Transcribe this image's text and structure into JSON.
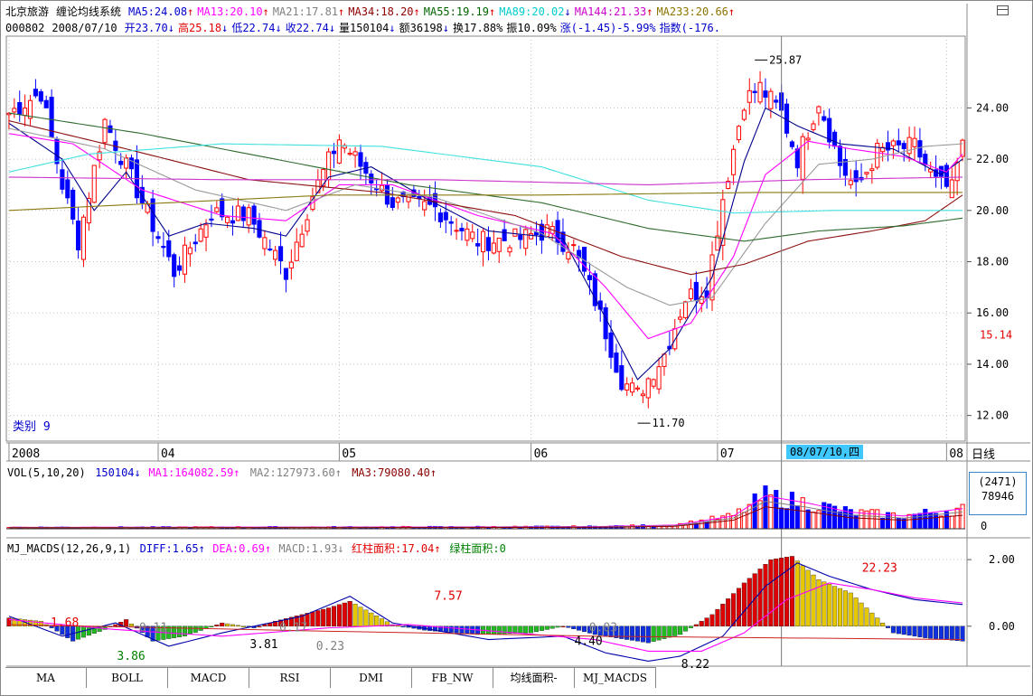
{
  "header": {
    "stock_name": "北京旅游",
    "system_name": "缠论均线系统",
    "ma_items": [
      {
        "label": "MA5:24.08",
        "arrow": "↑",
        "color": "#0000cc"
      },
      {
        "label": "MA13:20.10",
        "arrow": "↑",
        "color": "#ff00ff"
      },
      {
        "label": "MA21:17.81",
        "arrow": "↑",
        "color": "#808080"
      },
      {
        "label": "MA34:18.20",
        "arrow": "↑",
        "color": "#8b0000"
      },
      {
        "label": "MA55:19.19",
        "arrow": "↑",
        "color": "#006400"
      },
      {
        "label": "MA89:20.02",
        "arrow": "↓",
        "color": "#00cccc"
      },
      {
        "label": "MA144:21.33",
        "arrow": "↑",
        "color": "#cc00cc"
      },
      {
        "label": "MA233:20.66",
        "arrow": "↑",
        "color": "#8b7500"
      }
    ],
    "code": "000802",
    "date": "2008/07/10",
    "quote_items": [
      {
        "label": "开23.70",
        "arrow": "↓",
        "color": "#0000cc"
      },
      {
        "label": "高25.18",
        "arrow": "↓",
        "color": "#e00000"
      },
      {
        "label": "低22.74",
        "arrow": "↓",
        "color": "#0000cc"
      },
      {
        "label": "收22.74",
        "arrow": "↓",
        "color": "#0000cc"
      },
      {
        "label": "量150104",
        "arrow": "↓",
        "color": "#000000"
      },
      {
        "label": "额36198",
        "arrow": "↓",
        "color": "#000000"
      },
      {
        "label": "换17.88%",
        "arrow": "",
        "color": "#000000"
      },
      {
        "label": "振10.09%",
        "arrow": "",
        "color": "#000000"
      },
      {
        "label": "涨(-1.45)-5.99%",
        "arrow": "",
        "color": "#0000cc"
      },
      {
        "label": "指数(-176.",
        "arrow": "",
        "color": "#0000cc"
      }
    ]
  },
  "colors": {
    "up": "#ff0000",
    "down": "#0000ff",
    "macd_pos_strong": "#dd0000",
    "macd_pos_fade": "#e6c800",
    "macd_neg_strong": "#1030e0",
    "macd_neg_fade": "#22bb22",
    "grid": "#c0c0c0",
    "axis": "#808080"
  },
  "chart_data": [
    {
      "type": "candlestick",
      "title": "北京旅游 缠论均线系统",
      "ylim": [
        11.0,
        26.8
      ],
      "y_ticks": [
        "24.00",
        "22.00",
        "20.00",
        "18.00",
        "16.00",
        "14.00",
        "12.00"
      ],
      "y_tick_values": [
        24,
        22,
        20,
        18,
        16,
        14,
        12
      ],
      "current_price_label": "15.14",
      "current_price": 15.14,
      "x_tick_labels": [
        "2008",
        "04",
        "05",
        "06",
        "07",
        "08"
      ],
      "x_tick_index": [
        0,
        28,
        62,
        98,
        133,
        176
      ],
      "annotations": [
        {
          "text": "25.87",
          "index": 140,
          "value": 25.87
        },
        {
          "text": "11.70",
          "index": 118,
          "value": 11.7
        }
      ],
      "category_label": "类别 9",
      "cursor_date": "08/07/10,四",
      "period": "日线",
      "n_bars": 180,
      "anchors_close": [
        [
          0,
          23.8
        ],
        [
          6,
          24.6
        ],
        [
          10,
          21.0
        ],
        [
          13,
          18.8
        ],
        [
          18,
          23.5
        ],
        [
          24,
          20.8
        ],
        [
          31,
          17.6
        ],
        [
          38,
          19.9
        ],
        [
          45,
          19.8
        ],
        [
          52,
          17.6
        ],
        [
          57,
          20.6
        ],
        [
          62,
          22.8
        ],
        [
          67,
          21.5
        ],
        [
          72,
          20.3
        ],
        [
          80,
          20.1
        ],
        [
          88,
          18.8
        ],
        [
          96,
          18.9
        ],
        [
          101,
          19.2
        ],
        [
          106,
          18.5
        ],
        [
          110,
          16.5
        ],
        [
          115,
          13.4
        ],
        [
          118,
          12.8
        ],
        [
          123,
          14.4
        ],
        [
          127,
          16.6
        ],
        [
          131,
          17.0
        ],
        [
          134,
          20.5
        ],
        [
          138,
          24.3
        ],
        [
          141,
          24.8
        ],
        [
          145,
          23.8
        ],
        [
          148,
          22.0
        ],
        [
          152,
          24.3
        ],
        [
          156,
          21.8
        ],
        [
          159,
          20.8
        ],
        [
          163,
          22.3
        ],
        [
          170,
          22.5
        ],
        [
          174,
          21.1
        ],
        [
          177,
          20.8
        ],
        [
          179,
          22.74
        ]
      ],
      "ma_anchors": [
        {
          "name": "MA5",
          "color": "#00008b",
          "anchors": [
            [
              0,
              23.4
            ],
            [
              10,
              22.0
            ],
            [
              16,
              20.0
            ],
            [
              22,
              21.5
            ],
            [
              30,
              19.0
            ],
            [
              37,
              19.5
            ],
            [
              46,
              19.3
            ],
            [
              52,
              19.0
            ],
            [
              60,
              21.3
            ],
            [
              68,
              21.7
            ],
            [
              78,
              20.5
            ],
            [
              90,
              19.2
            ],
            [
              104,
              18.9
            ],
            [
              112,
              15.8
            ],
            [
              118,
              13.4
            ],
            [
              124,
              14.6
            ],
            [
              132,
              17.4
            ],
            [
              138,
              21.9
            ],
            [
              142,
              24.0
            ],
            [
              148,
              23.3
            ],
            [
              156,
              22.6
            ],
            [
              166,
              22.4
            ],
            [
              175,
              21.4
            ],
            [
              179,
              22.0
            ]
          ]
        },
        {
          "name": "MA13",
          "color": "#ff00ff",
          "anchors": [
            [
              0,
              23.0
            ],
            [
              12,
              22.6
            ],
            [
              25,
              20.8
            ],
            [
              40,
              19.8
            ],
            [
              52,
              19.6
            ],
            [
              62,
              21.0
            ],
            [
              72,
              21.0
            ],
            [
              88,
              19.8
            ],
            [
              102,
              19.1
            ],
            [
              112,
              17.0
            ],
            [
              120,
              15.0
            ],
            [
              128,
              15.6
            ],
            [
              136,
              18.2
            ],
            [
              142,
              21.4
            ],
            [
              150,
              22.7
            ],
            [
              158,
              22.4
            ],
            [
              168,
              22.1
            ],
            [
              176,
              21.5
            ],
            [
              179,
              22.2
            ]
          ]
        },
        {
          "name": "MA21",
          "color": "#9a9a9a",
          "anchors": [
            [
              0,
              23.2
            ],
            [
              18,
              22.4
            ],
            [
              35,
              20.8
            ],
            [
              52,
              20.0
            ],
            [
              65,
              21.0
            ],
            [
              80,
              20.5
            ],
            [
              100,
              19.1
            ],
            [
              116,
              17.0
            ],
            [
              124,
              16.3
            ],
            [
              132,
              16.6
            ],
            [
              142,
              19.5
            ],
            [
              152,
              21.8
            ],
            [
              162,
              22.0
            ],
            [
              172,
              22.5
            ],
            [
              179,
              22.6
            ]
          ]
        },
        {
          "name": "MA34",
          "color": "#8b1010",
          "anchors": [
            [
              0,
              23.5
            ],
            [
              22,
              22.4
            ],
            [
              45,
              21.2
            ],
            [
              70,
              20.7
            ],
            [
              95,
              19.8
            ],
            [
              115,
              18.2
            ],
            [
              128,
              17.5
            ],
            [
              138,
              17.9
            ],
            [
              150,
              18.8
            ],
            [
              162,
              19.2
            ],
            [
              172,
              19.6
            ],
            [
              179,
              20.6
            ]
          ]
        },
        {
          "name": "MA55",
          "color": "#2e6b2e",
          "anchors": [
            [
              0,
              23.8
            ],
            [
              25,
              23.0
            ],
            [
              50,
              22.0
            ],
            [
              75,
              21.0
            ],
            [
              100,
              20.3
            ],
            [
              120,
              19.3
            ],
            [
              138,
              18.8
            ],
            [
              152,
              19.2
            ],
            [
              168,
              19.4
            ],
            [
              179,
              19.7
            ]
          ]
        },
        {
          "name": "MA89",
          "color": "#40e0e0",
          "anchors": [
            [
              0,
              21.5
            ],
            [
              15,
              22.2
            ],
            [
              40,
              22.6
            ],
            [
              70,
              22.5
            ],
            [
              100,
              21.7
            ],
            [
              120,
              20.4
            ],
            [
              136,
              19.9
            ],
            [
              155,
              20.0
            ],
            [
              179,
              20.0
            ]
          ]
        },
        {
          "name": "MA144",
          "color": "#cc33cc",
          "anchors": [
            [
              0,
              21.3
            ],
            [
              40,
              21.2
            ],
            [
              80,
              21.2
            ],
            [
              120,
              21.0
            ],
            [
              150,
              21.2
            ],
            [
              179,
              21.3
            ]
          ]
        },
        {
          "name": "MA233",
          "color": "#8b7a10",
          "anchors": [
            [
              0,
              20.0
            ],
            [
              30,
              20.3
            ],
            [
              60,
              20.6
            ],
            [
              100,
              20.6
            ],
            [
              140,
              20.7
            ],
            [
              179,
              20.7
            ]
          ]
        }
      ]
    },
    {
      "type": "bar",
      "title": "VOL(5,10,20)",
      "value_label": "150104",
      "legend": [
        {
          "label": "VOL(5,10,20)",
          "color": "#000000"
        },
        {
          "label": "150104",
          "arrow": "↓",
          "color": "#0000cc"
        },
        {
          "label": "MA1:164082.59",
          "arrow": "↑",
          "color": "#ff00ff"
        },
        {
          "label": "MA2:127973.60",
          "arrow": "↑",
          "color": "#808080"
        },
        {
          "label": "MA3:79080.40",
          "arrow": "↑",
          "color": "#8b0000"
        }
      ],
      "y_labels": [
        "(2471)",
        "78946",
        "0"
      ],
      "volume_anchors": [
        [
          0,
          0.04
        ],
        [
          80,
          0.05
        ],
        [
          110,
          0.06
        ],
        [
          125,
          0.1
        ],
        [
          136,
          0.35
        ],
        [
          142,
          0.9
        ],
        [
          150,
          0.7
        ],
        [
          158,
          0.45
        ],
        [
          168,
          0.35
        ],
        [
          179,
          0.55
        ]
      ]
    },
    {
      "type": "bar",
      "title": "MJ_MACDS(12,26,9,1)",
      "legend": [
        {
          "label": "MJ_MACDS(12,26,9,1)",
          "color": "#000000"
        },
        {
          "label": "DIFF:1.65",
          "arrow": "↑",
          "color": "#0000cc"
        },
        {
          "label": "DEA:0.69",
          "arrow": "↑",
          "color": "#ff00ff"
        },
        {
          "label": "MACD:1.93",
          "arrow": "↓",
          "color": "#808080"
        },
        {
          "label": "红柱面积:17.04",
          "arrow": "↑",
          "color": "#e00000"
        },
        {
          "label": "绿柱面积:0",
          "arrow": "",
          "color": "#008000"
        }
      ],
      "ylim": [
        -1.2,
        2.6
      ],
      "y_ticks": [
        "2.00",
        "0.00"
      ],
      "y_tick_values": [
        2.0,
        0.0
      ],
      "hist_anchors": [
        [
          0,
          0.25
        ],
        [
          6,
          0.15
        ],
        [
          12,
          -0.45
        ],
        [
          18,
          -0.1
        ],
        [
          22,
          0.2
        ],
        [
          27,
          -0.45
        ],
        [
          33,
          -0.3
        ],
        [
          40,
          0.1
        ],
        [
          46,
          -0.05
        ],
        [
          50,
          0.15
        ],
        [
          55,
          0.35
        ],
        [
          60,
          0.55
        ],
        [
          64,
          0.75
        ],
        [
          68,
          0.4
        ],
        [
          72,
          0.05
        ],
        [
          78,
          -0.12
        ],
        [
          88,
          -0.25
        ],
        [
          98,
          -0.2
        ],
        [
          104,
          0.0
        ],
        [
          110,
          -0.25
        ],
        [
          116,
          -0.4
        ],
        [
          120,
          -0.5
        ],
        [
          126,
          -0.25
        ],
        [
          132,
          0.35
        ],
        [
          138,
          1.3
        ],
        [
          143,
          2.0
        ],
        [
          147,
          2.1
        ],
        [
          152,
          1.4
        ],
        [
          158,
          1.0
        ],
        [
          162,
          0.4
        ],
        [
          166,
          -0.2
        ],
        [
          172,
          -0.35
        ],
        [
          179,
          -0.45
        ]
      ],
      "diff_anchors": [
        [
          0,
          0.3
        ],
        [
          10,
          -0.3
        ],
        [
          20,
          0.1
        ],
        [
          30,
          -0.6
        ],
        [
          40,
          -0.2
        ],
        [
          55,
          0.3
        ],
        [
          64,
          0.9
        ],
        [
          72,
          0.1
        ],
        [
          90,
          -0.4
        ],
        [
          104,
          -0.3
        ],
        [
          112,
          -0.8
        ],
        [
          120,
          -1.05
        ],
        [
          126,
          -0.9
        ],
        [
          134,
          -0.3
        ],
        [
          142,
          1.2
        ],
        [
          148,
          1.9
        ],
        [
          154,
          1.5
        ],
        [
          162,
          1.1
        ],
        [
          170,
          0.8
        ],
        [
          179,
          0.65
        ]
      ],
      "dea_anchors": [
        [
          0,
          0.2
        ],
        [
          20,
          -0.1
        ],
        [
          40,
          -0.3
        ],
        [
          60,
          -0.05
        ],
        [
          75,
          0.05
        ],
        [
          95,
          -0.2
        ],
        [
          110,
          -0.4
        ],
        [
          120,
          -0.75
        ],
        [
          130,
          -0.75
        ],
        [
          138,
          -0.2
        ],
        [
          146,
          0.8
        ],
        [
          154,
          1.3
        ],
        [
          162,
          1.1
        ],
        [
          170,
          0.85
        ],
        [
          179,
          0.7
        ]
      ],
      "annotations": [
        {
          "text": "1.68",
          "index": 12,
          "value": 0.1,
          "color": "#e00000"
        },
        {
          "text": "3.86",
          "index": 30,
          "value": -0.9,
          "color": "#008000"
        },
        {
          "text": "0.11",
          "index": 36,
          "value": -0.05,
          "color": "#808080"
        },
        {
          "text": "3.81",
          "index": 66,
          "value": -0.55,
          "color": "#000000"
        },
        {
          "text": "0.17",
          "index": 74,
          "value": -0.05,
          "color": "#808080"
        },
        {
          "text": "0.23",
          "index": 84,
          "value": -0.6,
          "color": "#808080"
        },
        {
          "text": "7.57",
          "index": 116,
          "value": 0.9,
          "color": "#e00000"
        },
        {
          "text": "0.03",
          "index": 158,
          "value": -0.05,
          "color": "#808080"
        },
        {
          "text": "4.40",
          "index": 154,
          "value": -0.45,
          "color": "#000000"
        },
        {
          "text": "8.22",
          "index": 183,
          "value": -1.15,
          "color": "#000000"
        },
        {
          "text": "22.23",
          "index": 232,
          "value": 1.75,
          "color": "#e00000"
        }
      ]
    }
  ],
  "tabs": [
    "MA",
    "BOLL",
    "MACD",
    "RSI",
    "DMI",
    "FB_NW",
    "均线面积-",
    "MJ_MACDS"
  ]
}
